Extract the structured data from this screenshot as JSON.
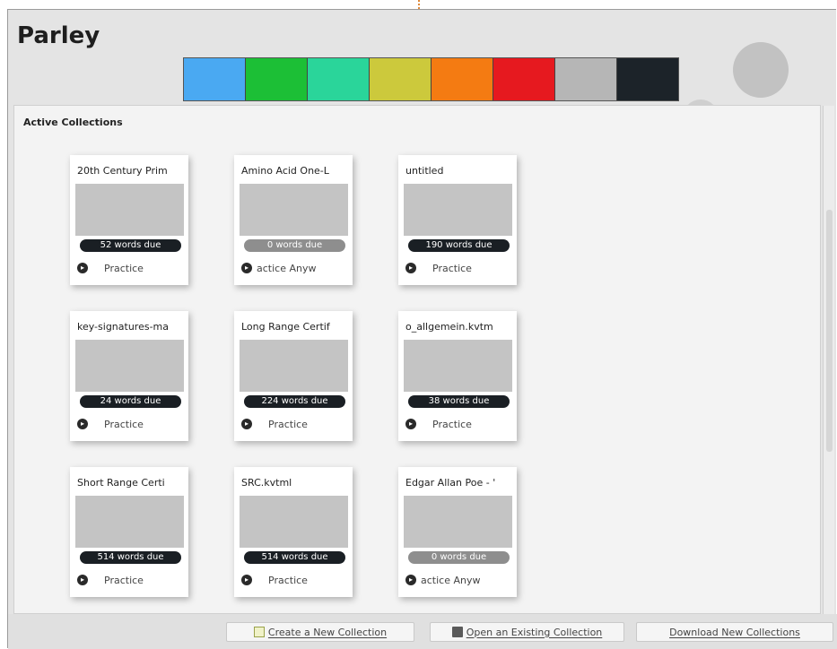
{
  "app": {
    "title": "Parley"
  },
  "colors": {
    "swatches": [
      "#4aa9f2",
      "#1cbf36",
      "#2ad59a",
      "#ccc93c",
      "#f47b12",
      "#e6191f",
      "#b6b6b6",
      "#1c2329"
    ],
    "badge_due": "#1a1f24",
    "badge_zero": "#8e8e8e"
  },
  "main": {
    "section_title": "Active Collections",
    "collections": [
      {
        "title": "20th Century Prim",
        "due": "52 words due",
        "action": "Practice",
        "zero": false
      },
      {
        "title": "Amino Acid One-L",
        "due": "0 words due",
        "action": "actice Anyw",
        "zero": true
      },
      {
        "title": "untitled",
        "due": "190 words due",
        "action": "Practice",
        "zero": false
      },
      {
        "title": "key-signatures-ma",
        "due": "24 words due",
        "action": "Practice",
        "zero": false
      },
      {
        "title": "Long Range Certif",
        "due": "224 words due",
        "action": "Practice",
        "zero": false
      },
      {
        "title": "o_allgemein.kvtm",
        "due": "38 words due",
        "action": "Practice",
        "zero": false
      },
      {
        "title": "Short Range Certi",
        "due": "514 words due",
        "action": "Practice",
        "zero": false
      },
      {
        "title": "SRC.kvtml",
        "due": "514 words due",
        "action": "Practice",
        "zero": false
      },
      {
        "title": "Edgar Allan Poe - '",
        "due": "0 words due",
        "action": "actice Anyw",
        "zero": true
      }
    ]
  },
  "footer": {
    "create_label": "Create a New Collection",
    "open_label": "Open an Existing Collection",
    "download_label": "Download New Collections"
  }
}
